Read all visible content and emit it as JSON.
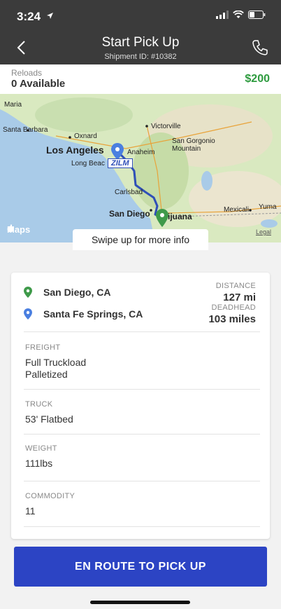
{
  "status_bar": {
    "time": "3:24"
  },
  "header": {
    "title": "Start Pick Up",
    "subtitle": "Shipment ID: #10382"
  },
  "reloads": {
    "label": "Reloads",
    "value": "0 Available",
    "price": "$200"
  },
  "map": {
    "labels": {
      "maria": "Maria",
      "victorville": "Victorville",
      "santa_barbara": "Santa Barbara",
      "oxnard": "Oxnard",
      "los_angeles": "Los Angeles",
      "anaheim": "Anaheim",
      "san_gorgonio": "San Gorgonio Mountain",
      "long_beach": "Long Beac",
      "carlsbad": "Carlsbad",
      "san_diego": "San Diego",
      "tijuana": "ijuana",
      "mexicali": "Mexicali",
      "yuma": "Yuma"
    },
    "badge": "ZILM",
    "logo": "Maps",
    "legal": "Legal"
  },
  "swipe_hint": "Swipe up for more info",
  "route": {
    "origin": "San Diego, CA",
    "destination": "Santa Fe Springs, CA",
    "distance_label": "DISTANCE",
    "distance_value": "127 mi",
    "deadhead_label": "DEADHEAD",
    "deadhead_value": "103 miles",
    "origin_color": "#3f9a4a",
    "destination_color": "#4a7fe0"
  },
  "details": {
    "freight_label": "FREIGHT",
    "freight_line1": "Full Truckload",
    "freight_line2": "Palletized",
    "truck_label": "TRUCK",
    "truck_value": "53' Flatbed",
    "weight_label": "WEIGHT",
    "weight_value": "111lbs",
    "commodity_label": "COMMODITY",
    "commodity_value": "11"
  },
  "cta_label": "EN ROUTE TO PICK UP",
  "colors": {
    "header_bg": "#3b3b3b",
    "accent_green": "#2e9b3f",
    "cta_blue": "#2c44c4"
  }
}
